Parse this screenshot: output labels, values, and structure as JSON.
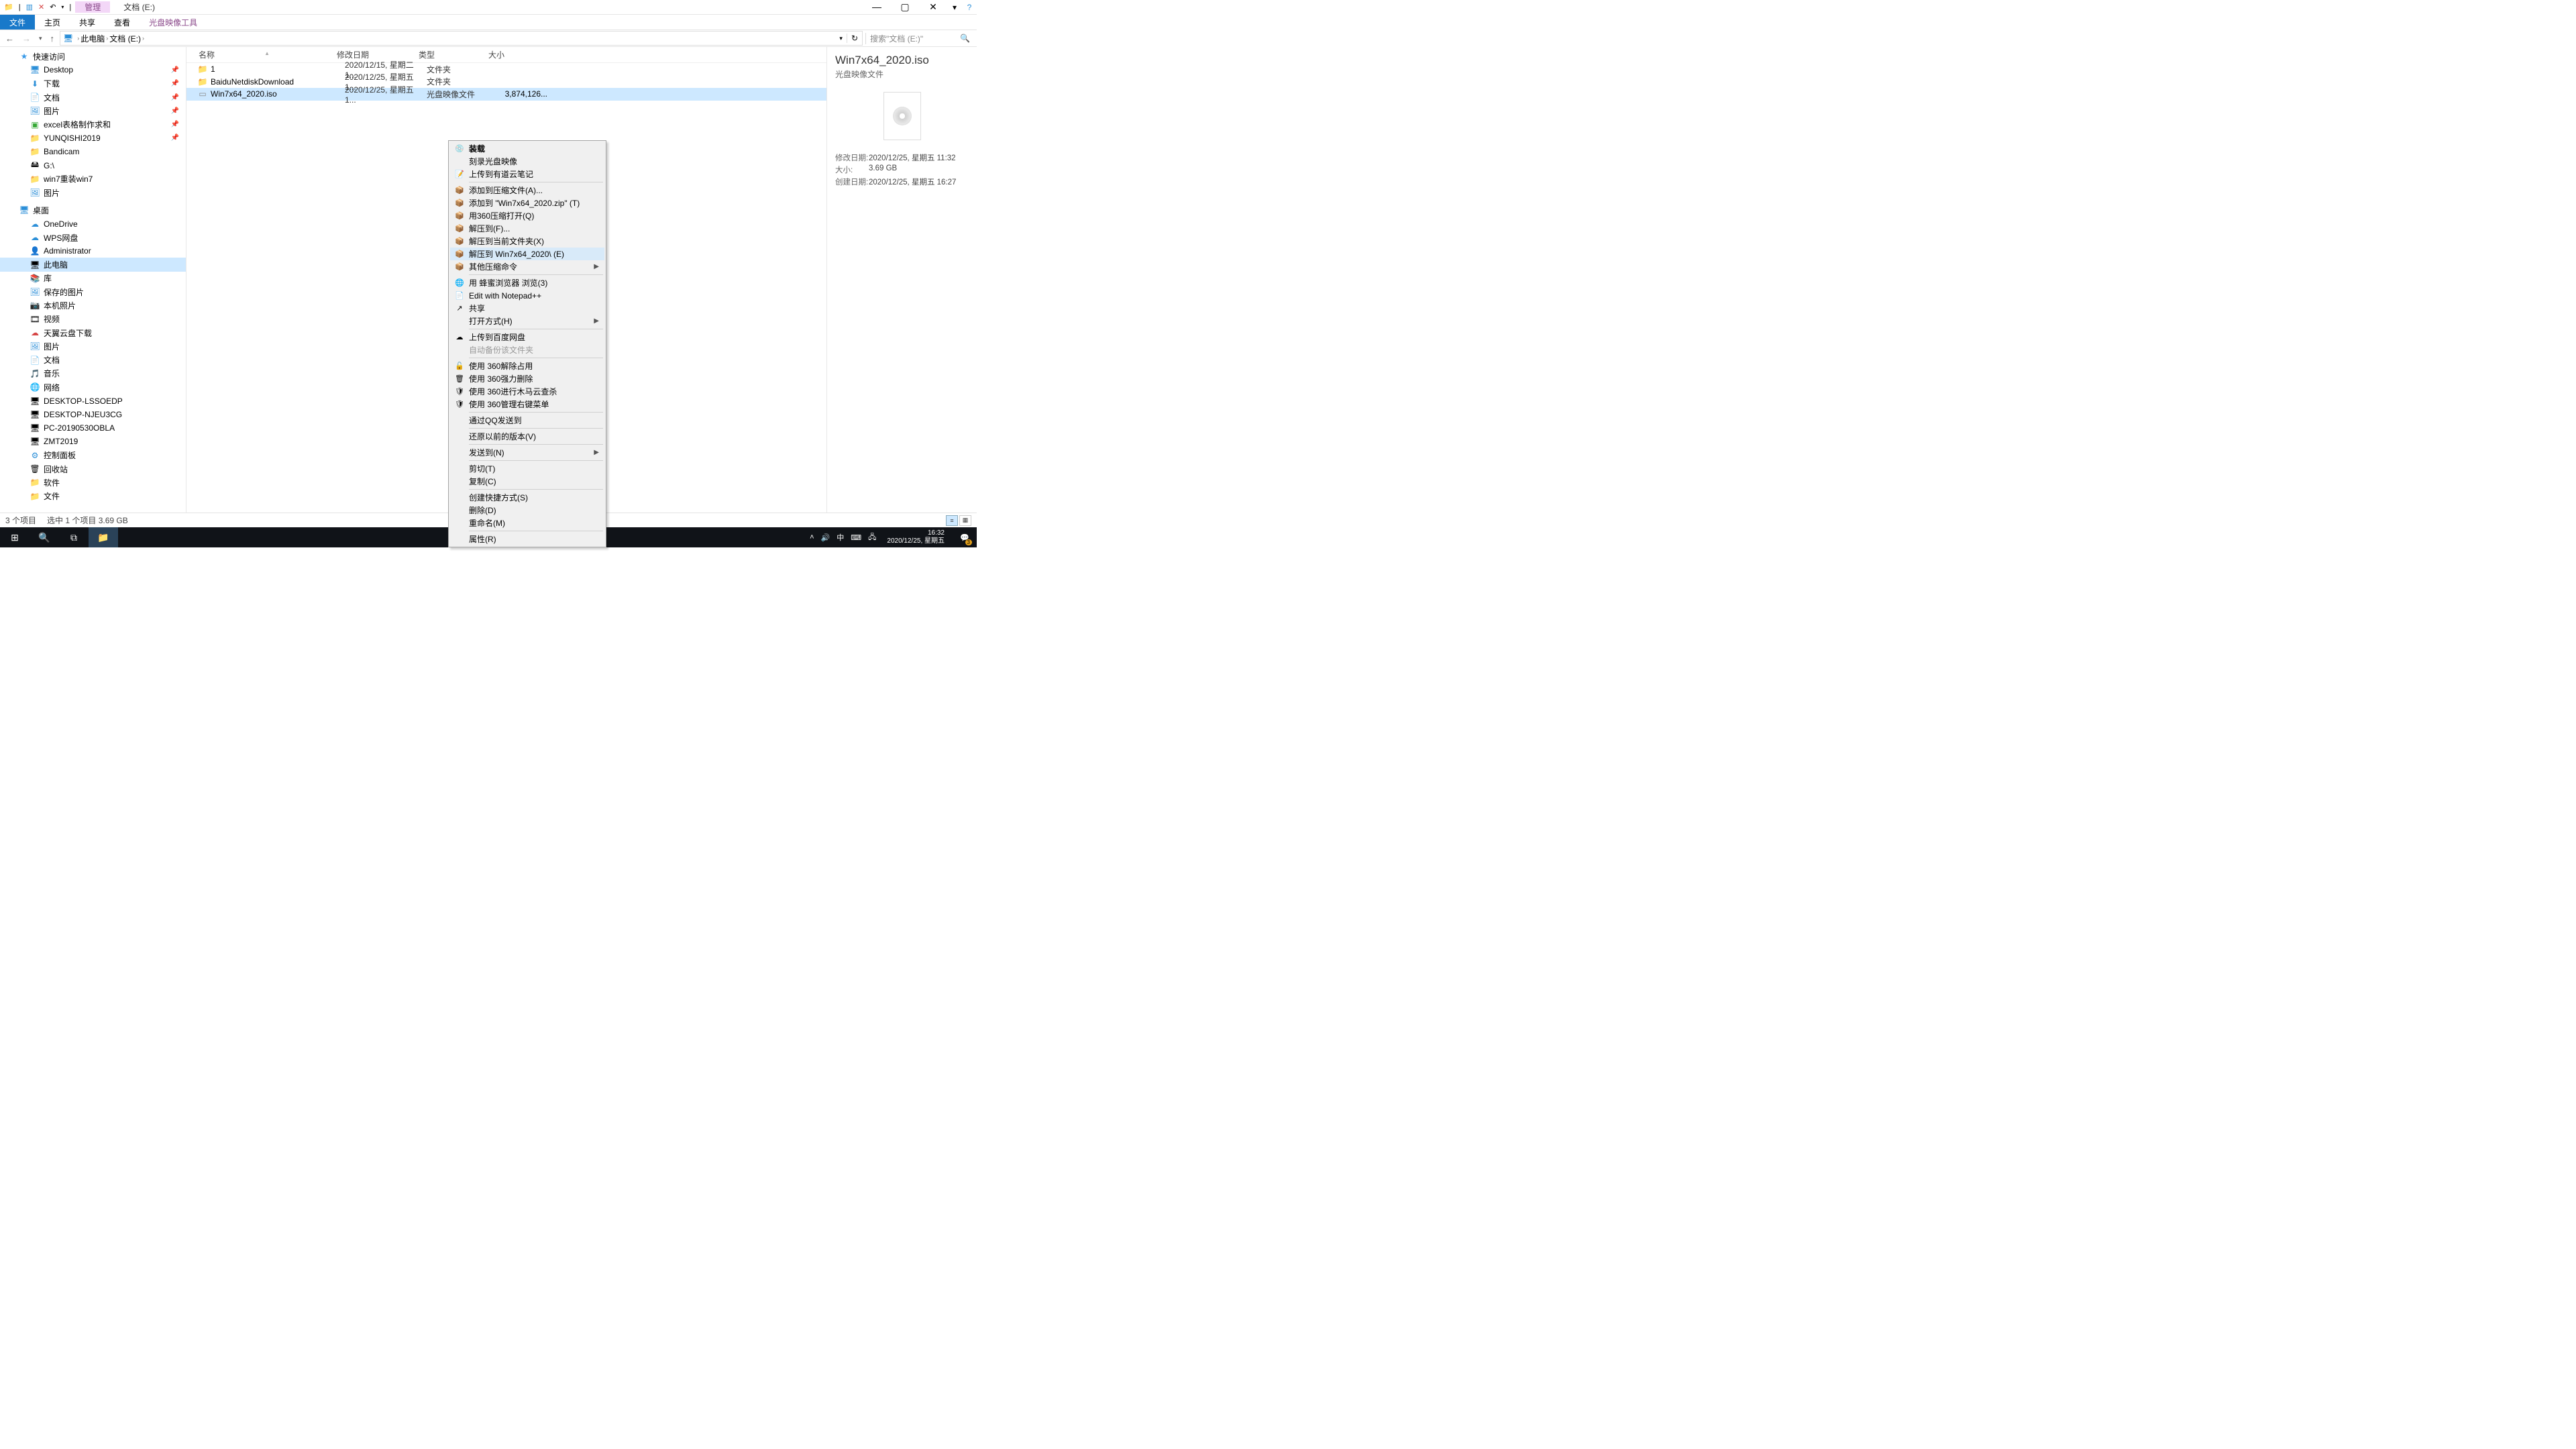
{
  "window": {
    "title": "文档 (E:)",
    "context_tab": "管理"
  },
  "ribbon": {
    "file": "文件",
    "home": "主页",
    "share": "共享",
    "view": "查看",
    "tool": "光盘映像工具"
  },
  "nav": {
    "back": "←",
    "forward": "→",
    "up": "↑",
    "crumbs": [
      "此电脑",
      "文档 (E:)"
    ],
    "search_placeholder": "搜索\"文档 (E:)\""
  },
  "tree": {
    "items": [
      {
        "d": 1,
        "icon": "★",
        "cls": "star",
        "label": "快速访问"
      },
      {
        "d": 2,
        "icon": "🖥",
        "cls": "blue",
        "label": "Desktop",
        "pin": true
      },
      {
        "d": 2,
        "icon": "⬇",
        "cls": "blue",
        "label": "下载",
        "pin": true
      },
      {
        "d": 2,
        "icon": "📄",
        "cls": "blue",
        "label": "文档",
        "pin": true
      },
      {
        "d": 2,
        "icon": "🖼",
        "cls": "blue",
        "label": "图片",
        "pin": true
      },
      {
        "d": 2,
        "icon": "▣",
        "cls": "green",
        "label": "excel表格制作求和",
        "pin": true
      },
      {
        "d": 2,
        "icon": "📁",
        "cls": "yellow",
        "label": "YUNQISHI2019",
        "pin": true
      },
      {
        "d": 2,
        "icon": "📁",
        "cls": "yellow",
        "label": "Bandicam"
      },
      {
        "d": 2,
        "icon": "🖴",
        "cls": "",
        "label": "G:\\"
      },
      {
        "d": 2,
        "icon": "📁",
        "cls": "yellow",
        "label": "win7重装win7"
      },
      {
        "d": 2,
        "icon": "🖼",
        "cls": "blue",
        "label": "图片"
      },
      {
        "d": 1,
        "icon": "🖥",
        "cls": "blue",
        "label": "桌面",
        "gap": true
      },
      {
        "d": 2,
        "icon": "☁",
        "cls": "blue",
        "label": "OneDrive"
      },
      {
        "d": 2,
        "icon": "☁",
        "cls": "blue",
        "label": "WPS网盘"
      },
      {
        "d": 2,
        "icon": "👤",
        "cls": "",
        "label": "Administrator"
      },
      {
        "d": 2,
        "icon": "🖥",
        "cls": "",
        "label": "此电脑",
        "selected": true
      },
      {
        "d": 2,
        "icon": "📚",
        "cls": "blue",
        "label": "库"
      },
      {
        "d": 2,
        "icon": "🖼",
        "cls": "blue",
        "label": "保存的图片",
        "d2": true
      },
      {
        "d": 2,
        "icon": "📷",
        "cls": "",
        "label": "本机照片",
        "d2": true
      },
      {
        "d": 2,
        "icon": "🎞",
        "cls": "",
        "label": "视频",
        "d2": true
      },
      {
        "d": 2,
        "icon": "☁",
        "cls": "red",
        "label": "天翼云盘下载",
        "d2": true
      },
      {
        "d": 2,
        "icon": "🖼",
        "cls": "blue",
        "label": "图片",
        "d2": true
      },
      {
        "d": 2,
        "icon": "📄",
        "cls": "blue",
        "label": "文档",
        "d2": true
      },
      {
        "d": 2,
        "icon": "🎵",
        "cls": "blue",
        "label": "音乐",
        "d2": true
      },
      {
        "d": 2,
        "icon": "🌐",
        "cls": "blue",
        "label": "网络"
      },
      {
        "d": 2,
        "icon": "🖥",
        "cls": "",
        "label": "DESKTOP-LSSOEDP",
        "d2": true
      },
      {
        "d": 2,
        "icon": "🖥",
        "cls": "",
        "label": "DESKTOP-NJEU3CG",
        "d2": true
      },
      {
        "d": 2,
        "icon": "🖥",
        "cls": "",
        "label": "PC-20190530OBLA",
        "d2": true
      },
      {
        "d": 2,
        "icon": "🖥",
        "cls": "",
        "label": "ZMT2019",
        "d2": true
      },
      {
        "d": 2,
        "icon": "⚙",
        "cls": "blue",
        "label": "控制面板"
      },
      {
        "d": 2,
        "icon": "🗑",
        "cls": "",
        "label": "回收站"
      },
      {
        "d": 2,
        "icon": "📁",
        "cls": "yellow",
        "label": "软件"
      },
      {
        "d": 2,
        "icon": "📁",
        "cls": "yellow",
        "label": "文件"
      }
    ]
  },
  "columns": {
    "name": "名称",
    "date": "修改日期",
    "type": "类型",
    "size": "大小"
  },
  "files": [
    {
      "icon": "folder",
      "name": "1",
      "date": "2020/12/15, 星期二 1...",
      "type": "文件夹",
      "size": ""
    },
    {
      "icon": "folder",
      "name": "BaiduNetdiskDownload",
      "date": "2020/12/25, 星期五 1...",
      "type": "文件夹",
      "size": ""
    },
    {
      "icon": "iso",
      "name": "Win7x64_2020.iso",
      "date": "2020/12/25, 星期五 1...",
      "type": "光盘映像文件",
      "size": "3,874,126...",
      "selected": true
    }
  ],
  "context_menu": [
    {
      "icon": "💿",
      "label": "装载",
      "bold": true
    },
    {
      "label": "刻录光盘映像"
    },
    {
      "icon": "📝",
      "label": "上传到有道云笔记",
      "iconbg": "#2a6fd6"
    },
    {
      "sep": true
    },
    {
      "icon": "📦",
      "label": "添加到压缩文件(A)..."
    },
    {
      "icon": "📦",
      "label": "添加到 \"Win7x64_2020.zip\" (T)"
    },
    {
      "icon": "📦",
      "label": "用360压缩打开(Q)"
    },
    {
      "icon": "📦",
      "label": "解压到(F)..."
    },
    {
      "icon": "📦",
      "label": "解压到当前文件夹(X)"
    },
    {
      "icon": "📦",
      "label": "解压到 Win7x64_2020\\ (E)",
      "hover": true
    },
    {
      "icon": "📦",
      "label": "其他压缩命令",
      "sub": true
    },
    {
      "sep": true
    },
    {
      "icon": "🌐",
      "label": "用 蜂蜜浏览器 浏览(3)"
    },
    {
      "icon": "📄",
      "label": "Edit with Notepad++"
    },
    {
      "icon": "↗",
      "label": "共享"
    },
    {
      "label": "打开方式(H)",
      "sub": true
    },
    {
      "sep": true
    },
    {
      "icon": "☁",
      "label": "上传到百度网盘"
    },
    {
      "label": "自动备份该文件夹",
      "disabled": true
    },
    {
      "sep": true
    },
    {
      "icon": "🔓",
      "label": "使用 360解除占用"
    },
    {
      "icon": "🗑",
      "label": "使用 360强力删除"
    },
    {
      "icon": "🛡",
      "label": "使用 360进行木马云查杀"
    },
    {
      "icon": "🛡",
      "label": "使用 360管理右键菜单"
    },
    {
      "sep": true
    },
    {
      "label": "通过QQ发送到"
    },
    {
      "sep": true
    },
    {
      "label": "还原以前的版本(V)"
    },
    {
      "sep": true
    },
    {
      "label": "发送到(N)",
      "sub": true
    },
    {
      "sep": true
    },
    {
      "label": "剪切(T)"
    },
    {
      "label": "复制(C)"
    },
    {
      "sep": true
    },
    {
      "label": "创建快捷方式(S)"
    },
    {
      "label": "删除(D)"
    },
    {
      "label": "重命名(M)"
    },
    {
      "sep": true
    },
    {
      "label": "属性(R)"
    }
  ],
  "preview": {
    "name": "Win7x64_2020.iso",
    "type": "光盘映像文件",
    "props": [
      {
        "lbl": "修改日期:",
        "val": "2020/12/25, 星期五 11:32"
      },
      {
        "lbl": "大小:",
        "val": "3.69 GB"
      },
      {
        "lbl": "创建日期:",
        "val": "2020/12/25, 星期五 16:27"
      }
    ]
  },
  "status": {
    "count": "3 个项目",
    "selection": "选中 1 个项目  3.69 GB"
  },
  "taskbar": {
    "time": "16:32",
    "date": "2020/12/25, 星期五",
    "ime": "中",
    "notif_badge": "3"
  }
}
